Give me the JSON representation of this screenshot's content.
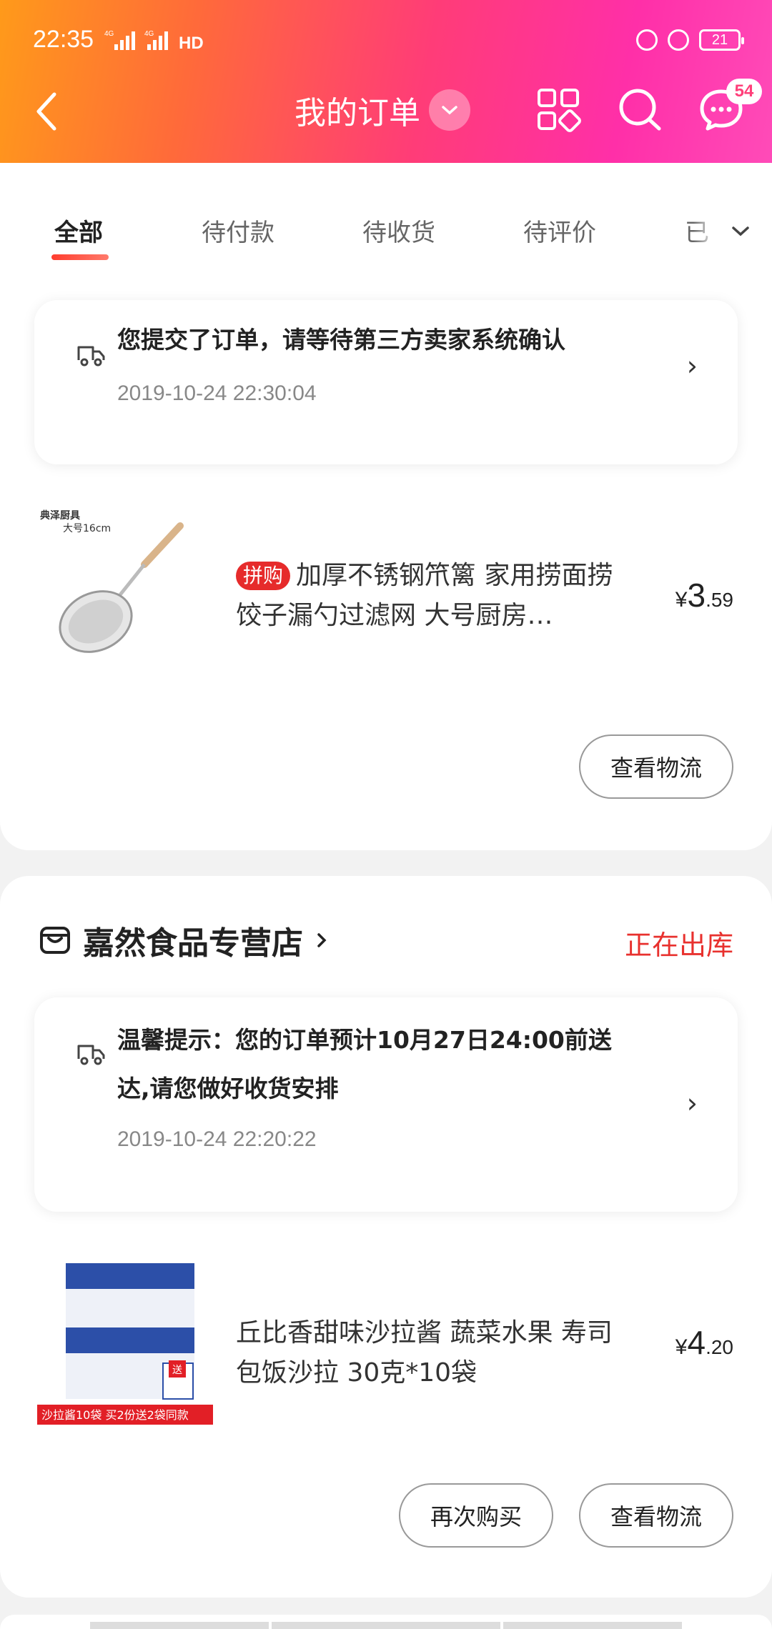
{
  "status_bar": {
    "time": "22:35",
    "network": "4G",
    "battery": "21"
  },
  "navbar": {
    "title": "我的订单",
    "message_badge": "54"
  },
  "tabs": [
    {
      "label": "全部",
      "active": true
    },
    {
      "label": "待付款",
      "active": false
    },
    {
      "label": "待收货",
      "active": false
    },
    {
      "label": "待评价",
      "active": false
    },
    {
      "label": "已",
      "active": false
    }
  ],
  "order1": {
    "notice_text": "您提交了订单，请等待第三方卖家系统确认",
    "notice_time": "2019-10-24 22:30:04",
    "product": {
      "tag": "拼购",
      "title": "加厚不锈钢笊篱 家用捞面捞饺子漏勺过滤网 大号厨房…",
      "price_symbol": "¥",
      "price_int": "3",
      "price_dec": ".59",
      "image_text1": "典泽厨具",
      "image_text2": "大号16cm"
    },
    "logistics_button": "查看物流"
  },
  "order2": {
    "shop_name": "嘉然食品专营店",
    "shop_status": "正在出库",
    "notice_line1": "温馨提示：您的订单预计10月27日24:00前送",
    "notice_line2": "达,请您做好收货安排",
    "notice_time": "2019-10-24 22:20:22",
    "product": {
      "title": "丘比香甜味沙拉酱 蔬菜水果 寿司包饭沙拉 30克*10袋",
      "price_symbol": "¥",
      "price_int": "4",
      "price_dec": ".20",
      "image_banner": "沙拉酱10袋 买2份送2袋同款",
      "image_gift": "送"
    },
    "rebuy_button": "再次购买",
    "logistics_button": "查看物流"
  },
  "colors": {
    "accent_red": "#e8312e",
    "header_gradient_start": "#ff9a1a",
    "header_gradient_end": "#ff2fa8"
  }
}
